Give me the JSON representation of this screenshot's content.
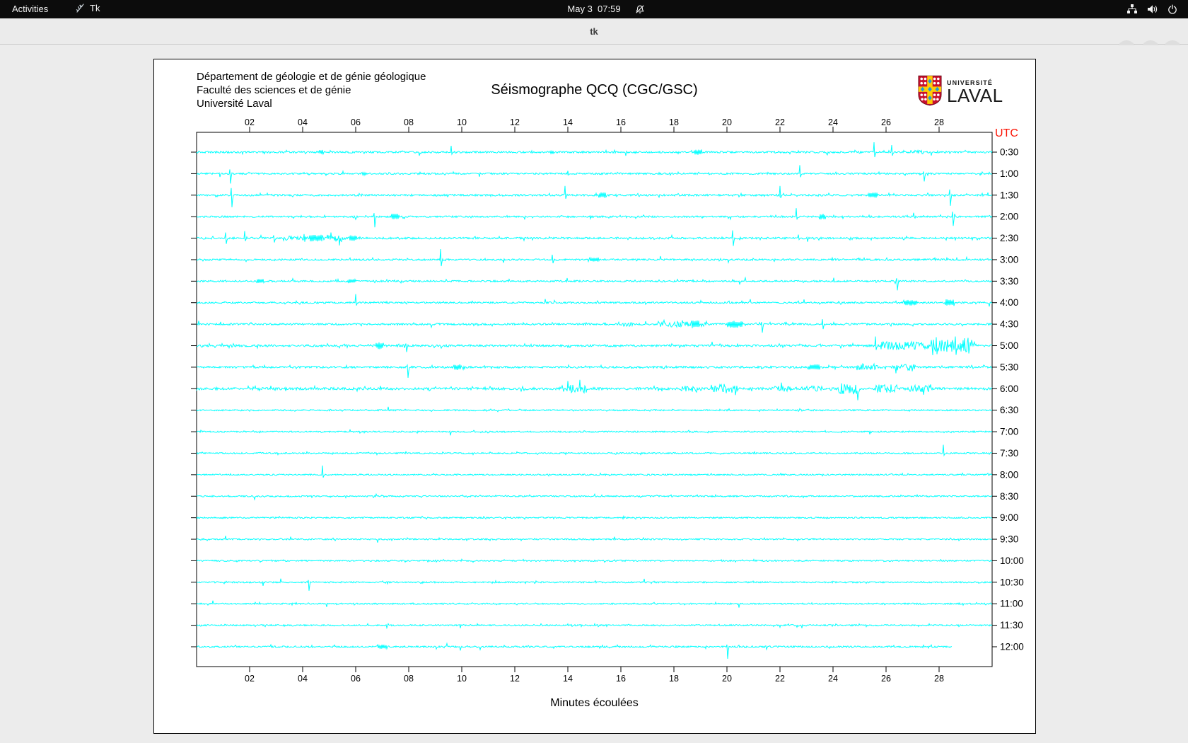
{
  "top_bar": {
    "activities_label": "Activities",
    "app_menu_label": "Tk",
    "clock": "May 3  07:59"
  },
  "window": {
    "title": "tk"
  },
  "seismograph": {
    "header_lines": [
      "Département de géologie et de génie géologique",
      "Faculté des sciences et de génie",
      "Université Laval"
    ],
    "title": "Séismographe QCQ (CGC/GSC)",
    "utc_label": "UTC",
    "x_axis_title": "Minutes écoulées",
    "logo": {
      "institution_small": "UNIVERSITÉ",
      "institution_large": "LAVAL"
    },
    "colors": {
      "trace": "#00ffff",
      "utc_label": "#fb1405",
      "axis": "#000000"
    },
    "x_ticks": [
      "02",
      "04",
      "06",
      "08",
      "10",
      "12",
      "14",
      "16",
      "18",
      "20",
      "22",
      "24",
      "26",
      "28"
    ],
    "minutes_per_row": 30,
    "rows": [
      {
        "label": "0:30",
        "base": 1.3,
        "hair": 0.006,
        "events": [
          {
            "t": "blob",
            "m": 4.7,
            "w": 0.15,
            "amp": 3
          },
          {
            "t": "spike",
            "m": 9.6,
            "up": 9,
            "dn": 3
          },
          {
            "t": "blob",
            "m": 13.4,
            "w": 0.15,
            "amp": 2.5
          },
          {
            "t": "blob",
            "m": 18.9,
            "w": 0.3,
            "amp": 4
          },
          {
            "t": "spike",
            "m": 25.55,
            "up": 14,
            "dn": 7
          },
          {
            "t": "spike",
            "m": 26.2,
            "up": 10,
            "dn": 5
          },
          {
            "t": "burst",
            "m0": 26.9,
            "m1": 27.4,
            "amp": 2.5
          }
        ]
      },
      {
        "label": "1:00",
        "base": 1.2,
        "hair": 0.005,
        "events": [
          {
            "t": "spike",
            "m": 1.25,
            "up": 6,
            "dn": 14
          },
          {
            "t": "blob",
            "m": 6.3,
            "w": 0.15,
            "amp": 2.5
          },
          {
            "t": "spike",
            "m": 14.0,
            "up": 4,
            "dn": 2
          },
          {
            "t": "spike",
            "m": 22.75,
            "up": 12,
            "dn": 5
          },
          {
            "t": "spike",
            "m": 27.4,
            "up": 3,
            "dn": 11
          }
        ]
      },
      {
        "label": "1:30",
        "base": 1.3,
        "hair": 0.006,
        "events": [
          {
            "t": "spike",
            "m": 1.3,
            "up": 10,
            "dn": 17
          },
          {
            "t": "spike",
            "m": 13.9,
            "up": 13,
            "dn": 5
          },
          {
            "t": "blob",
            "m": 15.3,
            "w": 0.3,
            "amp": 4
          },
          {
            "t": "spike",
            "m": 22.0,
            "up": 13,
            "dn": 4
          },
          {
            "t": "blob",
            "m": 25.5,
            "w": 0.35,
            "amp": 4
          },
          {
            "t": "spike",
            "m": 28.4,
            "up": 8,
            "dn": 15
          }
        ]
      },
      {
        "label": "2:00",
        "base": 1.2,
        "hair": 0.005,
        "events": [
          {
            "t": "spike",
            "m": 6.7,
            "up": 5,
            "dn": 15
          },
          {
            "t": "blob",
            "m": 7.5,
            "w": 0.3,
            "amp": 4
          },
          {
            "t": "spike",
            "m": 22.6,
            "up": 12,
            "dn": 4
          },
          {
            "t": "blob",
            "m": 23.6,
            "w": 0.25,
            "amp": 4
          },
          {
            "t": "spike",
            "m": 28.5,
            "up": 7,
            "dn": 13
          }
        ]
      },
      {
        "label": "2:30",
        "base": 1.3,
        "hair": 0.007,
        "events": [
          {
            "t": "spike",
            "m": 1.1,
            "up": 8,
            "dn": 8
          },
          {
            "t": "spike",
            "m": 1.8,
            "up": 10,
            "dn": 4
          },
          {
            "t": "spike",
            "m": 2.9,
            "up": 4,
            "dn": 6
          },
          {
            "t": "burst",
            "m0": 3.3,
            "m1": 4.2,
            "amp": 3
          },
          {
            "t": "blob",
            "m": 4.5,
            "w": 0.5,
            "amp": 5
          },
          {
            "t": "burst",
            "m0": 4.8,
            "m1": 5.6,
            "amp": 5
          },
          {
            "t": "blob",
            "m": 5.9,
            "w": 0.3,
            "amp": 4
          },
          {
            "t": "spike",
            "m": 20.2,
            "up": 11,
            "dn": 11
          },
          {
            "t": "spike",
            "m": 22.7,
            "up": 5,
            "dn": 2
          }
        ]
      },
      {
        "label": "3:00",
        "base": 1.2,
        "hair": 0.005,
        "events": [
          {
            "t": "spike",
            "m": 9.2,
            "up": 15,
            "dn": 9
          },
          {
            "t": "spike",
            "m": 13.4,
            "up": 7,
            "dn": 5
          },
          {
            "t": "blob",
            "m": 15.0,
            "w": 0.35,
            "amp": 3
          }
        ]
      },
      {
        "label": "3:30",
        "base": 1.2,
        "hair": 0.005,
        "events": [
          {
            "t": "blob",
            "m": 2.4,
            "w": 0.3,
            "amp": 3
          },
          {
            "t": "blob",
            "m": 5.85,
            "w": 0.25,
            "amp": 3
          },
          {
            "t": "spike",
            "m": 26.4,
            "up": 4,
            "dn": 13
          }
        ]
      },
      {
        "label": "4:00",
        "base": 1.2,
        "hair": 0.005,
        "events": [
          {
            "t": "spike",
            "m": 6.0,
            "up": 12,
            "dn": 4
          },
          {
            "t": "blob",
            "m": 26.9,
            "w": 0.5,
            "amp": 4
          },
          {
            "t": "blob",
            "m": 28.4,
            "w": 0.35,
            "amp": 5
          }
        ]
      },
      {
        "label": "4:30",
        "base": 1.3,
        "hair": 0.006,
        "events": [
          {
            "t": "burst",
            "m0": 16.0,
            "m1": 16.5,
            "amp": 3
          },
          {
            "t": "burst",
            "m0": 17.4,
            "m1": 19.3,
            "amp": 4
          },
          {
            "t": "blob",
            "m": 18.8,
            "w": 0.3,
            "amp": 6
          },
          {
            "t": "blob",
            "m": 20.3,
            "w": 0.6,
            "amp": 5
          },
          {
            "t": "spike",
            "m": 21.3,
            "up": 3,
            "dn": 12
          },
          {
            "t": "spike",
            "m": 23.6,
            "up": 7,
            "dn": 7
          }
        ]
      },
      {
        "label": "5:00",
        "base": 1.5,
        "hair": 0.007,
        "events": [
          {
            "t": "blob",
            "m": 6.9,
            "w": 0.3,
            "amp": 5
          },
          {
            "t": "spike",
            "m": 7.9,
            "up": 3,
            "dn": 9
          },
          {
            "t": "spike",
            "m": 25.6,
            "up": 13,
            "dn": 6
          },
          {
            "t": "burst",
            "m0": 25.8,
            "m1": 27.6,
            "amp": 6
          },
          {
            "t": "burst",
            "m0": 27.7,
            "m1": 29.4,
            "amp": 9
          },
          {
            "t": "spike",
            "m": 27.9,
            "up": 12,
            "dn": 12
          },
          {
            "t": "spike",
            "m": 28.6,
            "up": 13,
            "dn": 13
          },
          {
            "t": "spike",
            "m": 29.1,
            "up": 11,
            "dn": 11
          }
        ]
      },
      {
        "label": "5:30",
        "base": 1.4,
        "hair": 0.006,
        "events": [
          {
            "t": "spike",
            "m": 7.95,
            "up": 3,
            "dn": 15
          },
          {
            "t": "blob",
            "m": 9.85,
            "w": 0.3,
            "amp": 4
          },
          {
            "t": "blob",
            "m": 23.3,
            "w": 0.4,
            "amp": 4
          },
          {
            "t": "burst",
            "m0": 24.9,
            "m1": 25.7,
            "amp": 5
          },
          {
            "t": "burst",
            "m0": 26.2,
            "m1": 27.1,
            "amp": 5
          }
        ]
      },
      {
        "label": "6:00",
        "base": 1.7,
        "hair": 0.008,
        "events": [
          {
            "t": "burst",
            "m0": 13.7,
            "m1": 14.7,
            "amp": 6
          },
          {
            "t": "burst",
            "m0": 18.2,
            "m1": 18.9,
            "amp": 4
          },
          {
            "t": "burst",
            "m0": 19.4,
            "m1": 20.4,
            "amp": 7
          },
          {
            "t": "spike",
            "m": 20.3,
            "up": 4,
            "dn": 9
          },
          {
            "t": "burst",
            "m0": 21.7,
            "m1": 22.4,
            "amp": 4
          },
          {
            "t": "burst",
            "m0": 23.0,
            "m1": 23.6,
            "amp": 4
          },
          {
            "t": "burst",
            "m0": 24.2,
            "m1": 25.0,
            "amp": 8
          },
          {
            "t": "burst",
            "m0": 25.6,
            "m1": 26.4,
            "amp": 6
          },
          {
            "t": "burst",
            "m0": 26.9,
            "m1": 27.7,
            "amp": 5
          }
        ]
      },
      {
        "label": "6:30",
        "base": 1.0,
        "hair": 0.002,
        "events": []
      },
      {
        "label": "7:00",
        "base": 1.0,
        "hair": 0.002,
        "events": []
      },
      {
        "label": "7:30",
        "base": 1.0,
        "hair": 0.002,
        "events": [
          {
            "t": "spike",
            "m": 28.15,
            "up": 12,
            "dn": 3
          }
        ]
      },
      {
        "label": "8:00",
        "base": 1.0,
        "hair": 0.002,
        "events": [
          {
            "t": "spike",
            "m": 4.75,
            "up": 13,
            "dn": 4
          }
        ]
      },
      {
        "label": "8:30",
        "base": 1.0,
        "hair": 0.002,
        "events": []
      },
      {
        "label": "9:00",
        "base": 1.0,
        "hair": 0.002,
        "events": []
      },
      {
        "label": "9:30",
        "base": 1.0,
        "hair": 0.002,
        "events": []
      },
      {
        "label": "10:00",
        "base": 1.0,
        "hair": 0.002,
        "events": []
      },
      {
        "label": "10:30",
        "base": 1.0,
        "hair": 0.002,
        "events": [
          {
            "t": "spike",
            "m": 4.2,
            "up": 3,
            "dn": 12
          }
        ]
      },
      {
        "label": "11:00",
        "base": 1.0,
        "hair": 0.002,
        "events": []
      },
      {
        "label": "11:30",
        "base": 1.0,
        "hair": 0.002,
        "events": []
      },
      {
        "label": "12:00",
        "base": 1.2,
        "hair": 0.003,
        "end": 28.5,
        "events": [
          {
            "t": "blob",
            "m": 7.0,
            "w": 0.4,
            "amp": 3
          },
          {
            "t": "spike",
            "m": 20.0,
            "up": 3,
            "dn": 17
          }
        ]
      }
    ]
  }
}
